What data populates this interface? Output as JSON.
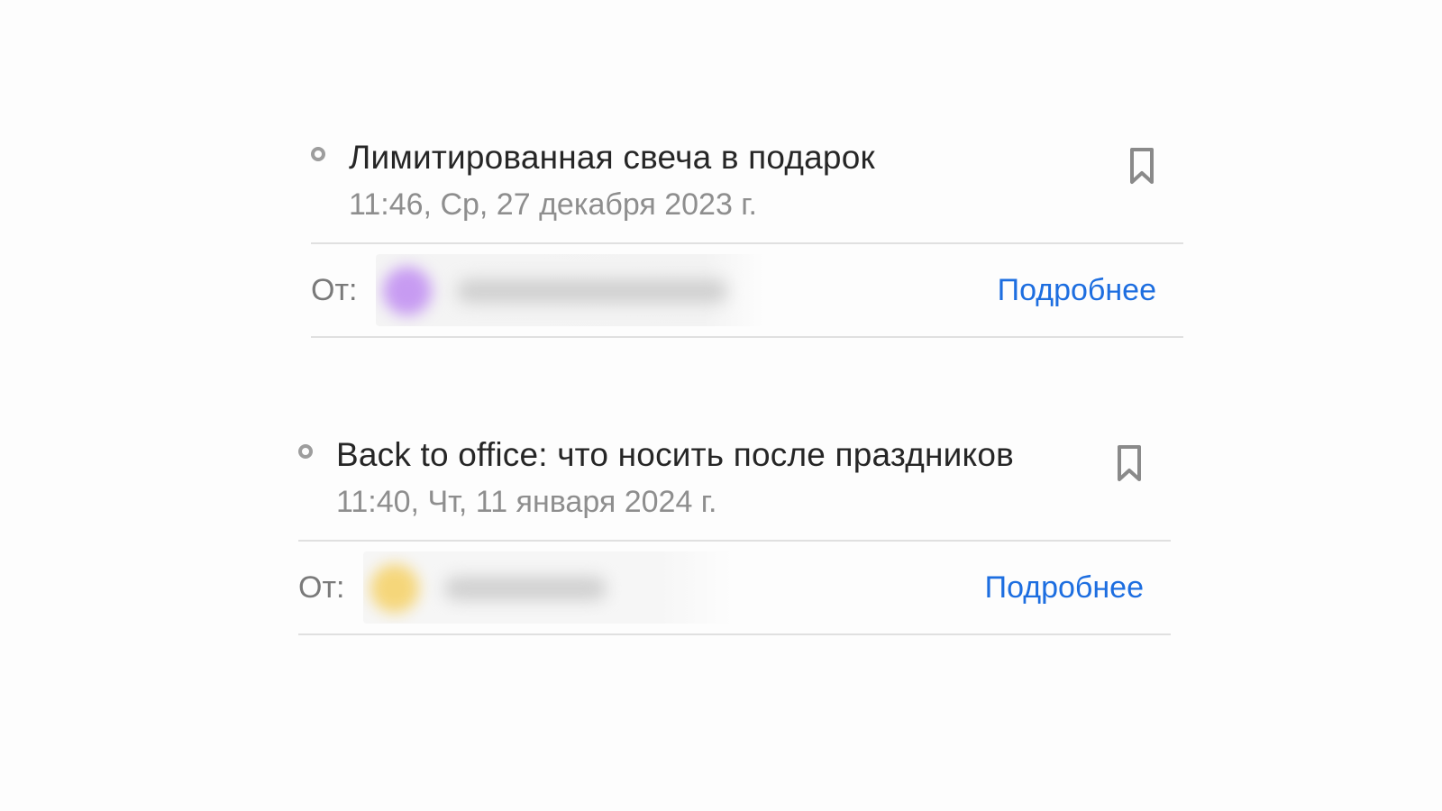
{
  "emails": [
    {
      "subject": "Лимитированная свеча в подарок",
      "date": "11:46, Ср, 27 декабря 2023 г.",
      "from_label": "От:",
      "more_link": "Подробнее",
      "avatar_color": "#c79bf2"
    },
    {
      "subject": "Back to office: что носить после праздников",
      "date": "11:40, Чт, 11 января 2024 г.",
      "from_label": "От:",
      "more_link": "Подробнее",
      "avatar_color": "#f5d67a"
    }
  ],
  "colors": {
    "link": "#1d6ee0",
    "subject_text": "#262626",
    "secondary_text": "#8e8e8e",
    "divider": "#e0e0e0"
  },
  "icons": {
    "unread": "unread-circle-icon",
    "bookmark": "bookmark-icon"
  }
}
